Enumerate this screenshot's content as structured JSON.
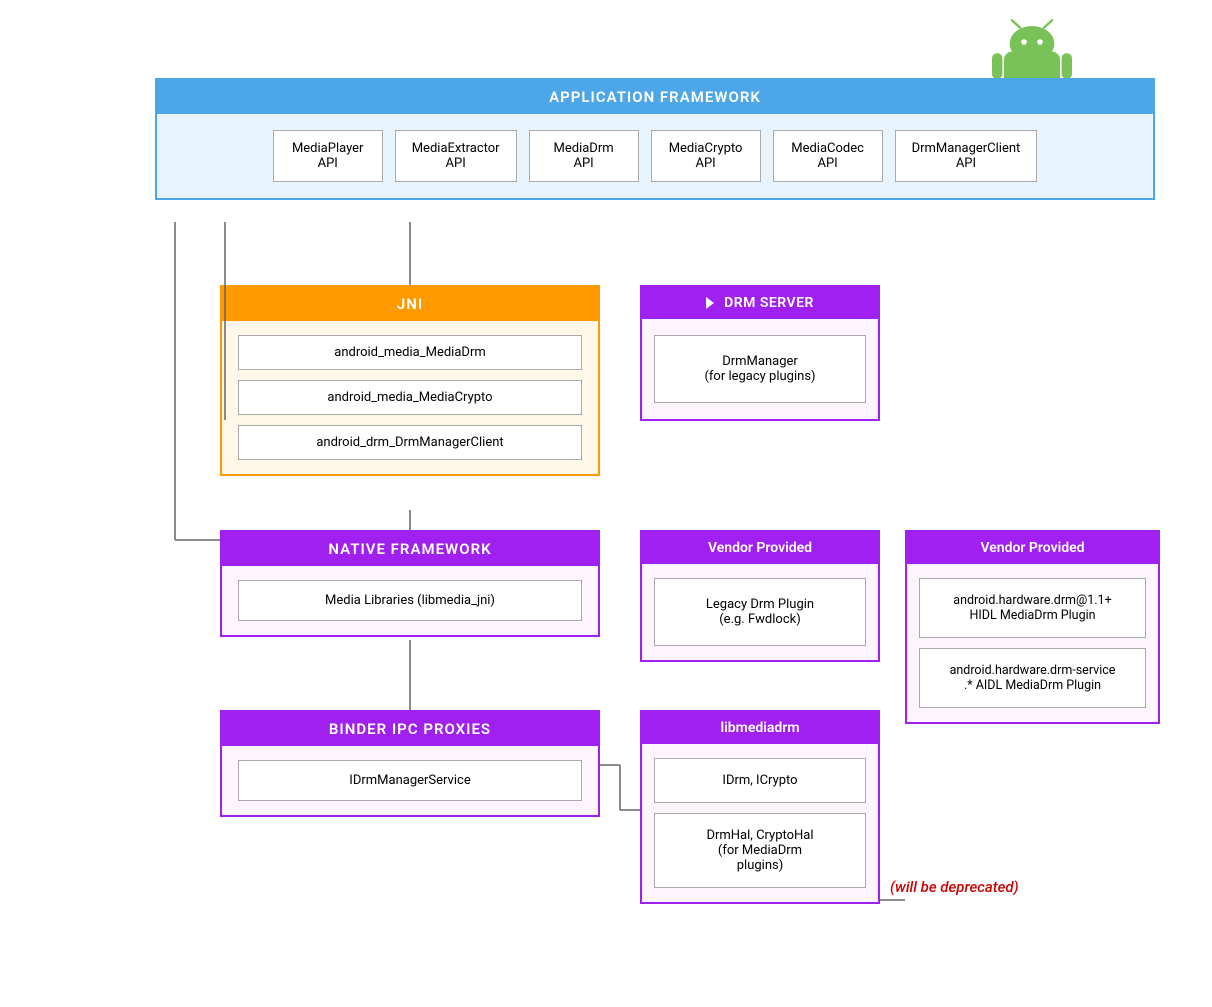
{
  "android_logo": {
    "alt": "Android Logo"
  },
  "app_framework": {
    "header": "APPLICATION FRAMEWORK",
    "apis": [
      {
        "label": "MediaPlayer\nAPI"
      },
      {
        "label": "MediaExtractor\nAPI"
      },
      {
        "label": "MediaDrm\nAPI"
      },
      {
        "label": "MediaCrypto\nAPI"
      },
      {
        "label": "MediaCodec\nAPI"
      },
      {
        "label": "DrmManagerClient\nAPI"
      }
    ]
  },
  "jni": {
    "header": "JNI",
    "items": [
      "android_media_MediaDrm",
      "android_media_MediaCrypto",
      "android_drm_DrmManagerClient"
    ]
  },
  "drm_server": {
    "header": "DRM SERVER",
    "item": "DrmManager\n(for legacy plugins)"
  },
  "native_framework": {
    "header": "NATIVE FRAMEWORK",
    "item": "Media Libraries (libmedia_jni)"
  },
  "vendor_left": {
    "header": "Vendor Provided",
    "item": "Legacy Drm Plugin\n(e.g. Fwdlock)"
  },
  "vendor_right": {
    "header": "Vendor Provided",
    "items": [
      "android.hardware.drm@1.1+\nHIDL MediaDrm Plugin",
      "android.hardware.drm-service\n.* AIDL MediaDrm Plugin"
    ]
  },
  "binder_ipc": {
    "header": "BINDER IPC PROXIES",
    "item": "IDrmManagerService"
  },
  "libmediadrm": {
    "header": "libmediadrm",
    "items": [
      "IDrm, ICrypto",
      "DrmHal, CryptoHal\n(for MediaDrm\nplugins)"
    ]
  },
  "deprecated": "(will be deprecated)"
}
